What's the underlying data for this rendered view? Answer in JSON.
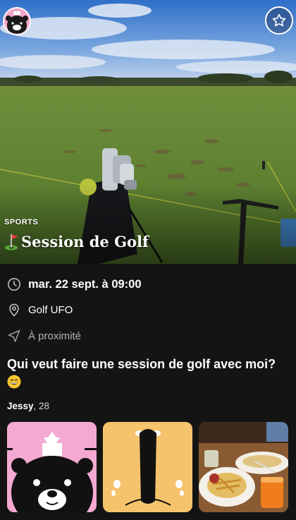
{
  "hero": {
    "category": "SPORTS",
    "title": "Session de Golf",
    "title_icon": "golf-flag-icon",
    "favorite_icon": "star-outline-icon",
    "host_avatar_icon": "bear-avatar-icon"
  },
  "details": {
    "date": "mar. 22 sept. à 09:00",
    "date_icon": "clock-icon",
    "location": "Golf UFO",
    "location_icon": "map-pin-icon",
    "distance": "À proximité",
    "distance_icon": "location-arrow-icon"
  },
  "description": {
    "text": "Qui veut faire une session de golf avec moi?",
    "emoji": "grinning-face-emoji"
  },
  "host": {
    "name": "Jessy",
    "age": ", 28"
  },
  "photos": [
    {
      "name": "bear-character-photo",
      "bg": "#f4a9d2"
    },
    {
      "name": "otter-character-photo",
      "bg": "#f5c36b"
    },
    {
      "name": "restaurant-food-photo",
      "bg": "#6b4a2b"
    }
  ],
  "colors": {
    "background": "#141414",
    "muted_text": "#b5b5b5"
  }
}
